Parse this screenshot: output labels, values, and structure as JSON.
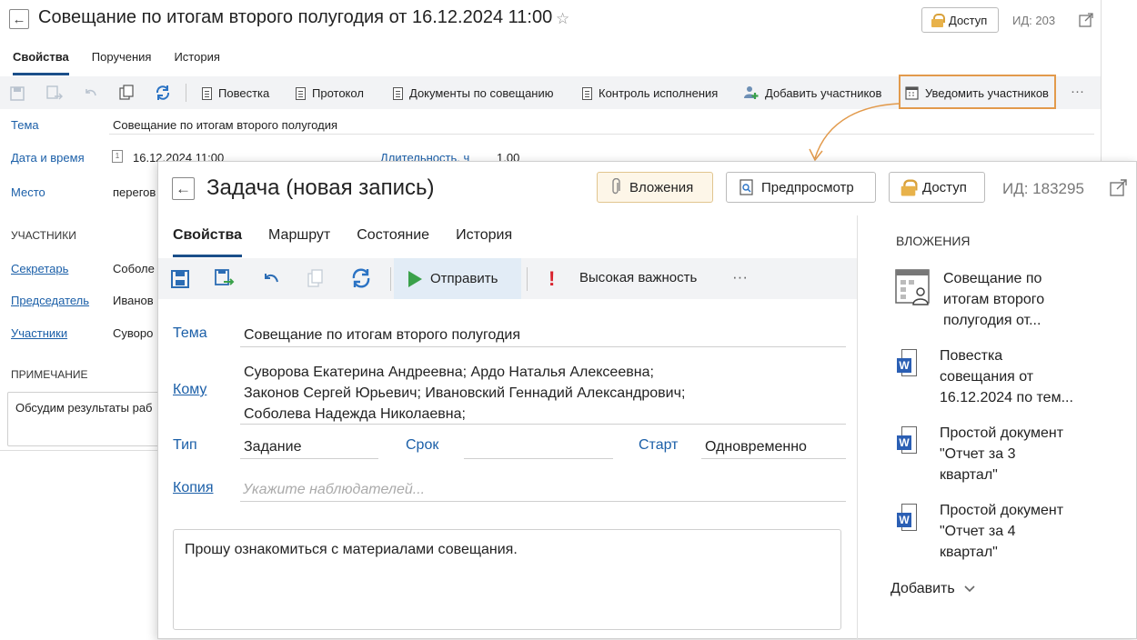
{
  "bg_window": {
    "title": "Совещание по итогам второго полугодия от 16.12.2024 11:00",
    "access_label": "Доступ",
    "id_label": "ИД: 203",
    "tabs": [
      {
        "label": "Свойства"
      },
      {
        "label": "Поручения"
      },
      {
        "label": "История"
      }
    ],
    "toolbar": {
      "items": [
        {
          "label": "Повестка",
          "icon": "document-icon"
        },
        {
          "label": "Протокол",
          "icon": "document-icon"
        },
        {
          "label": "Документы по совещанию",
          "icon": "documents-icon"
        },
        {
          "label": "Контроль исполнения",
          "icon": "control-icon"
        },
        {
          "label": "Добавить участников",
          "icon": "add-user-icon"
        },
        {
          "label": "Уведомить участников",
          "icon": "calendar-icon"
        }
      ],
      "more": "···"
    },
    "fields": {
      "topic_label": "Тема",
      "topic_value": "Совещание по итогам  второго полугодия",
      "datetime_label": "Дата и время",
      "datetime_value": "16.12.2024 11:00",
      "duration_label": "Длительность, ч",
      "duration_value": "1,00",
      "place_label": "Место",
      "place_value": "перегов",
      "participants_header": "УЧАСТНИКИ",
      "secretary_label": "Секретарь",
      "secretary_value": "Соболе",
      "chair_label": "Председатель",
      "chair_value": "Иванов",
      "members_label": "Участники",
      "members_value": "Суворо",
      "note_header": "ПРИМЕЧАНИЕ",
      "note_value": "Обсудим результаты раб"
    }
  },
  "dialog": {
    "title": "Задача (новая запись)",
    "attachments_button": "Вложения",
    "preview_button": "Предпросмотр",
    "access_button": "Доступ",
    "id_label": "ИД: 183295",
    "tabs": [
      {
        "label": "Свойства"
      },
      {
        "label": "Маршрут"
      },
      {
        "label": "Состояние"
      },
      {
        "label": "История"
      }
    ],
    "toolbar": {
      "send": "Отправить",
      "importance": "Высокая важность",
      "more": "···"
    },
    "fields": {
      "topic_label": "Тема",
      "topic_value": "Совещание по итогам  второго полугодия",
      "to_label": "Кому",
      "to_lines": [
        "Суворова Екатерина Андреевна; Ардо Наталья Алексеевна;",
        "Законов Сергей Юрьевич; Ивановский Геннадий Александрович;",
        "Соболева Надежда Николаевна;"
      ],
      "type_label": "Тип",
      "type_value": "Задание",
      "deadline_label": "Срок",
      "deadline_value": "",
      "start_label": "Старт",
      "start_value": "Одновременно",
      "copy_label": "Копия",
      "copy_placeholder": "Укажите наблюдателей...",
      "body_text": "Прошу ознакомиться с материалами совещания."
    },
    "attachments": {
      "header": "ВЛОЖЕНИЯ",
      "items": [
        {
          "lines": [
            "Совещание по",
            "итогам второго",
            "полугодия от..."
          ],
          "icon": "meeting-icon"
        },
        {
          "lines": [
            "Повестка",
            "совещания от",
            "16.12.2024 по тем..."
          ],
          "icon": "word-icon"
        },
        {
          "lines": [
            "Простой документ",
            "\"Отчет за 3",
            "квартал\""
          ],
          "icon": "word-icon"
        },
        {
          "lines": [
            "Простой документ",
            "\"Отчет за 4",
            "квартал\""
          ],
          "icon": "word-icon"
        }
      ],
      "add_label": "Добавить"
    }
  },
  "colors": {
    "accent": "#1b5fa8",
    "tab_underline": "#1b4f8a",
    "highlight": "#e29a4c",
    "send": "#3aa14a",
    "important": "#d9232e"
  }
}
